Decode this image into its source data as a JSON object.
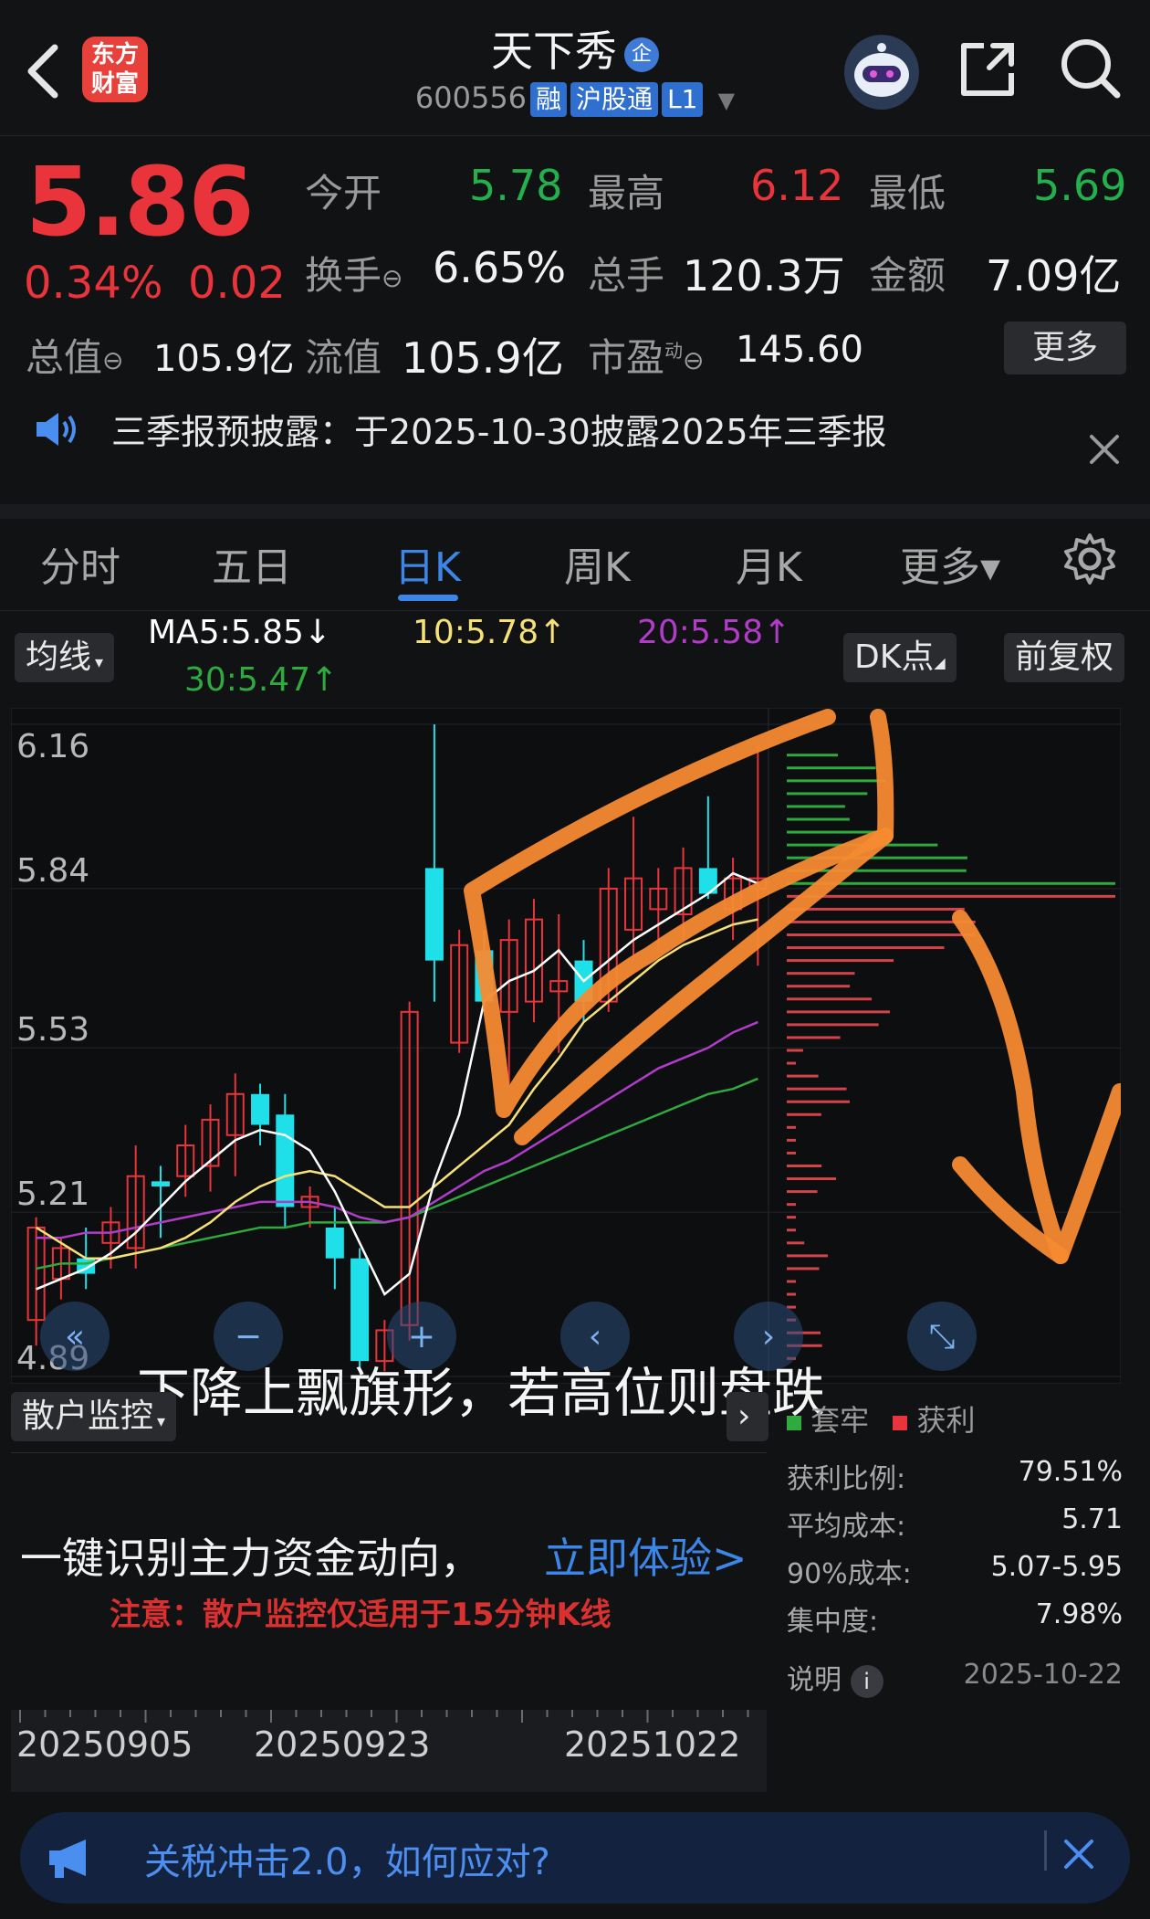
{
  "header": {
    "logo_text": "东方\n财富",
    "stock_name": "天下秀",
    "company_badge": "企",
    "stock_code": "600556",
    "tags": [
      "融",
      "沪股通",
      "L1"
    ]
  },
  "quote": {
    "price": "5.86",
    "pct_change": "0.34%",
    "change": "0.02",
    "fields": [
      {
        "label": "今开",
        "value": "5.78",
        "color": "green"
      },
      {
        "label": "最高",
        "value": "6.12",
        "color": "red"
      },
      {
        "label": "最低",
        "value": "5.69",
        "color": "green"
      },
      {
        "label": "换手",
        "value": "6.65%",
        "color": "white"
      },
      {
        "label": "总手",
        "value": "120.3万",
        "color": "white"
      },
      {
        "label": "金额",
        "value": "7.09亿",
        "color": "white"
      },
      {
        "label": "总值",
        "value": "105.9亿",
        "color": "white"
      },
      {
        "label": "流值",
        "value": "105.9亿",
        "color": "white"
      },
      {
        "label": "市盈",
        "label_sup": "动",
        "value": "145.60",
        "color": "white"
      }
    ],
    "more_label": "更多"
  },
  "notice": {
    "text": "三季报预披露：于2025-10-30披露2025年三季报"
  },
  "tabs": [
    {
      "label": "分时",
      "active": false
    },
    {
      "label": "五日",
      "active": false
    },
    {
      "label": "日K",
      "active": true
    },
    {
      "label": "周K",
      "active": false
    },
    {
      "label": "月K",
      "active": false
    },
    {
      "label": "更多▾",
      "active": false
    }
  ],
  "indicator_bar": {
    "ma_select": "均线",
    "ma5": "MA5:5.85↓",
    "ma10": "10:5.78↑",
    "ma20": "20:5.58↑",
    "ma30": "30:5.47↑",
    "dk_button": "DK点",
    "adjust_button": "前复权",
    "colors": {
      "ma5": "#ffffff",
      "ma10": "#f5e07a",
      "ma20": "#b03cc8",
      "ma30": "#2eaa3e"
    }
  },
  "chart_data": {
    "type": "candlestick",
    "y_ticks": [
      "6.16",
      "5.84",
      "5.53",
      "5.21",
      "4.89"
    ],
    "ylim": [
      4.89,
      6.16
    ],
    "candles": [
      {
        "o": 5.0,
        "h": 5.2,
        "l": 4.95,
        "c": 5.18
      },
      {
        "o": 5.08,
        "h": 5.16,
        "l": 5.04,
        "c": 5.14
      },
      {
        "o": 5.12,
        "h": 5.18,
        "l": 5.06,
        "c": 5.09
      },
      {
        "o": 5.15,
        "h": 5.22,
        "l": 5.1,
        "c": 5.19
      },
      {
        "o": 5.14,
        "h": 5.34,
        "l": 5.1,
        "c": 5.28
      },
      {
        "o": 5.27,
        "h": 5.3,
        "l": 5.16,
        "c": 5.26
      },
      {
        "o": 5.28,
        "h": 5.38,
        "l": 5.24,
        "c": 5.34
      },
      {
        "o": 5.3,
        "h": 5.42,
        "l": 5.25,
        "c": 5.39
      },
      {
        "o": 5.36,
        "h": 5.48,
        "l": 5.28,
        "c": 5.44
      },
      {
        "o": 5.44,
        "h": 5.46,
        "l": 5.34,
        "c": 5.38
      },
      {
        "o": 5.4,
        "h": 5.44,
        "l": 5.18,
        "c": 5.22
      },
      {
        "o": 5.22,
        "h": 5.26,
        "l": 5.18,
        "c": 5.24
      },
      {
        "o": 5.18,
        "h": 5.22,
        "l": 5.06,
        "c": 5.12
      },
      {
        "o": 5.12,
        "h": 5.14,
        "l": 4.9,
        "c": 4.92
      },
      {
        "o": 4.92,
        "h": 5.0,
        "l": 4.9,
        "c": 4.98
      },
      {
        "o": 4.99,
        "h": 5.62,
        "l": 4.96,
        "c": 5.6
      },
      {
        "o": 5.88,
        "h": 6.16,
        "l": 5.62,
        "c": 5.7
      },
      {
        "o": 5.54,
        "h": 5.76,
        "l": 5.52,
        "c": 5.73
      },
      {
        "o": 5.72,
        "h": 5.76,
        "l": 5.6,
        "c": 5.62
      },
      {
        "o": 5.6,
        "h": 5.78,
        "l": 5.46,
        "c": 5.74
      },
      {
        "o": 5.62,
        "h": 5.82,
        "l": 5.58,
        "c": 5.78
      },
      {
        "o": 5.64,
        "h": 5.79,
        "l": 5.52,
        "c": 5.66
      },
      {
        "o": 5.7,
        "h": 5.74,
        "l": 5.58,
        "c": 5.62
      },
      {
        "o": 5.62,
        "h": 5.88,
        "l": 5.6,
        "c": 5.84
      },
      {
        "o": 5.76,
        "h": 5.98,
        "l": 5.7,
        "c": 5.86
      },
      {
        "o": 5.8,
        "h": 5.88,
        "l": 5.72,
        "c": 5.84
      },
      {
        "o": 5.79,
        "h": 5.92,
        "l": 5.74,
        "c": 5.88
      },
      {
        "o": 5.88,
        "h": 6.02,
        "l": 5.82,
        "c": 5.83
      },
      {
        "o": 5.8,
        "h": 5.9,
        "l": 5.74,
        "c": 5.86
      },
      {
        "o": 5.84,
        "h": 6.12,
        "l": 5.69,
        "c": 5.86
      }
    ],
    "ma5": [
      5.06,
      5.08,
      5.1,
      5.13,
      5.17,
      5.22,
      5.27,
      5.31,
      5.35,
      5.37,
      5.36,
      5.33,
      5.25,
      5.15,
      5.05,
      5.09,
      5.27,
      5.4,
      5.62,
      5.66,
      5.68,
      5.72,
      5.66,
      5.7,
      5.74,
      5.77,
      5.8,
      5.83,
      5.87,
      5.85
    ],
    "ma10": [
      5.18,
      5.15,
      5.12,
      5.12,
      5.13,
      5.14,
      5.16,
      5.19,
      5.23,
      5.26,
      5.28,
      5.29,
      5.28,
      5.25,
      5.22,
      5.22,
      5.26,
      5.3,
      5.34,
      5.38,
      5.45,
      5.51,
      5.58,
      5.62,
      5.66,
      5.7,
      5.73,
      5.75,
      5.77,
      5.78
    ],
    "ma20": [
      5.16,
      5.16,
      5.17,
      5.17,
      5.18,
      5.19,
      5.2,
      5.21,
      5.22,
      5.23,
      5.23,
      5.23,
      5.22,
      5.2,
      5.19,
      5.2,
      5.23,
      5.26,
      5.29,
      5.31,
      5.34,
      5.37,
      5.4,
      5.43,
      5.46,
      5.49,
      5.51,
      5.53,
      5.56,
      5.58
    ],
    "ma30": [
      5.1,
      5.11,
      5.11,
      5.12,
      5.13,
      5.14,
      5.15,
      5.16,
      5.17,
      5.18,
      5.18,
      5.19,
      5.19,
      5.19,
      5.19,
      5.2,
      5.22,
      5.24,
      5.26,
      5.28,
      5.3,
      5.32,
      5.34,
      5.36,
      5.38,
      5.4,
      5.42,
      5.44,
      5.45,
      5.47
    ]
  },
  "chart_nav": [
    "«",
    "−",
    "+",
    "‹",
    "›",
    "⤡"
  ],
  "annotation_caption": "下降上飘旗形，若高位则盘跌",
  "chip_legend": {
    "trapped": "套牢",
    "profit": "获利"
  },
  "lower_panel": {
    "select": "散户监控",
    "cta_text": "一键识别主力资金动向，",
    "cta_link": "立即体验>",
    "note": "注意：散户监控仅适用于15分钟K线"
  },
  "chip_stats": [
    {
      "label": "获利比例:",
      "value": "79.51%"
    },
    {
      "label": "平均成本:",
      "value": "5.71"
    },
    {
      "label": "90%成本:",
      "value": "5.07-5.95"
    },
    {
      "label": "集中度:",
      "value": "7.98%"
    }
  ],
  "chip_footer": {
    "label": "说明",
    "date": "2025-10-22"
  },
  "x_dates": [
    "20250905",
    "20250923",
    "20251022"
  ],
  "banner": {
    "text": "关税冲击2.0，如何应对?"
  }
}
